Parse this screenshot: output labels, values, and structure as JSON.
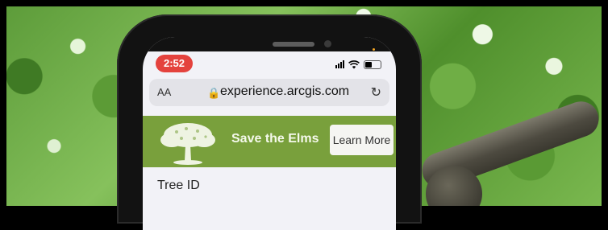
{
  "status": {
    "time": "2:52"
  },
  "browser": {
    "aa": "AA",
    "url": "experience.arcgis.com"
  },
  "banner": {
    "title": "Save the Elms",
    "button": "Learn More"
  },
  "form": {
    "tree_id_label": "Tree ID"
  },
  "colors": {
    "banner": "#79a03c",
    "time_pill": "#e4423d"
  }
}
